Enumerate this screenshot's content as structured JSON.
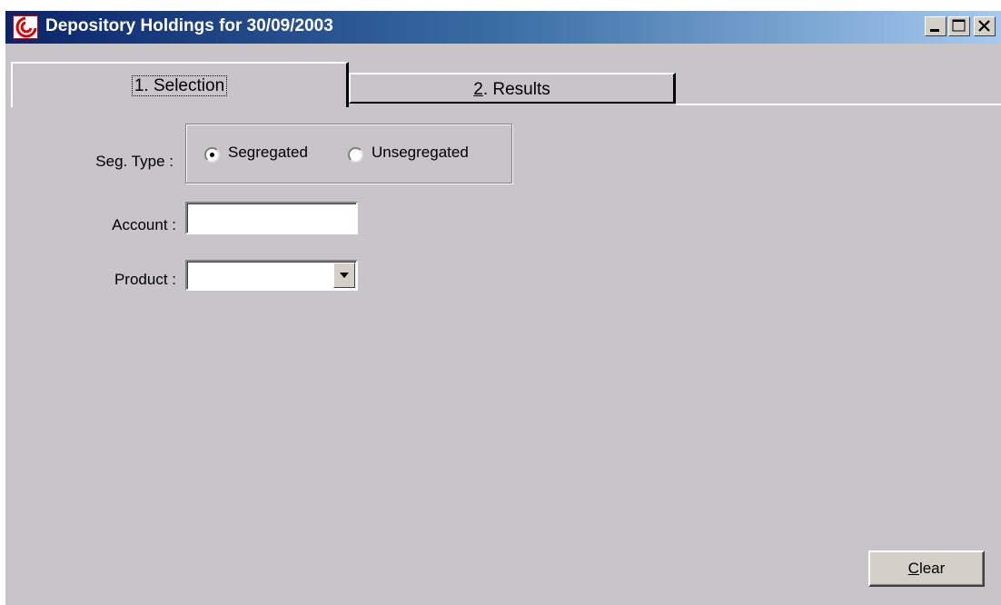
{
  "window": {
    "title": "Depository Holdings for 30/09/2003"
  },
  "tabs": [
    {
      "label": "1. Selection",
      "selected": true
    },
    {
      "label": "2. Results",
      "mnemonic": "2",
      "selected": false
    }
  ],
  "form": {
    "seg_type_label": "Seg. Type :",
    "seg_options": [
      {
        "label": "Segregated",
        "checked": true
      },
      {
        "label": "Unsegregated",
        "checked": false
      }
    ],
    "account_label": "Account :",
    "account_value": "",
    "product_label": "Product :",
    "product_value": ""
  },
  "buttons": {
    "clear_label": "Clear",
    "clear_mnemonic": "C"
  },
  "icons": {
    "app": "app-logo-icon",
    "minimize": "minimize-icon",
    "maximize": "maximize-icon",
    "close": "close-icon",
    "dropdown": "chevron-down-icon"
  }
}
